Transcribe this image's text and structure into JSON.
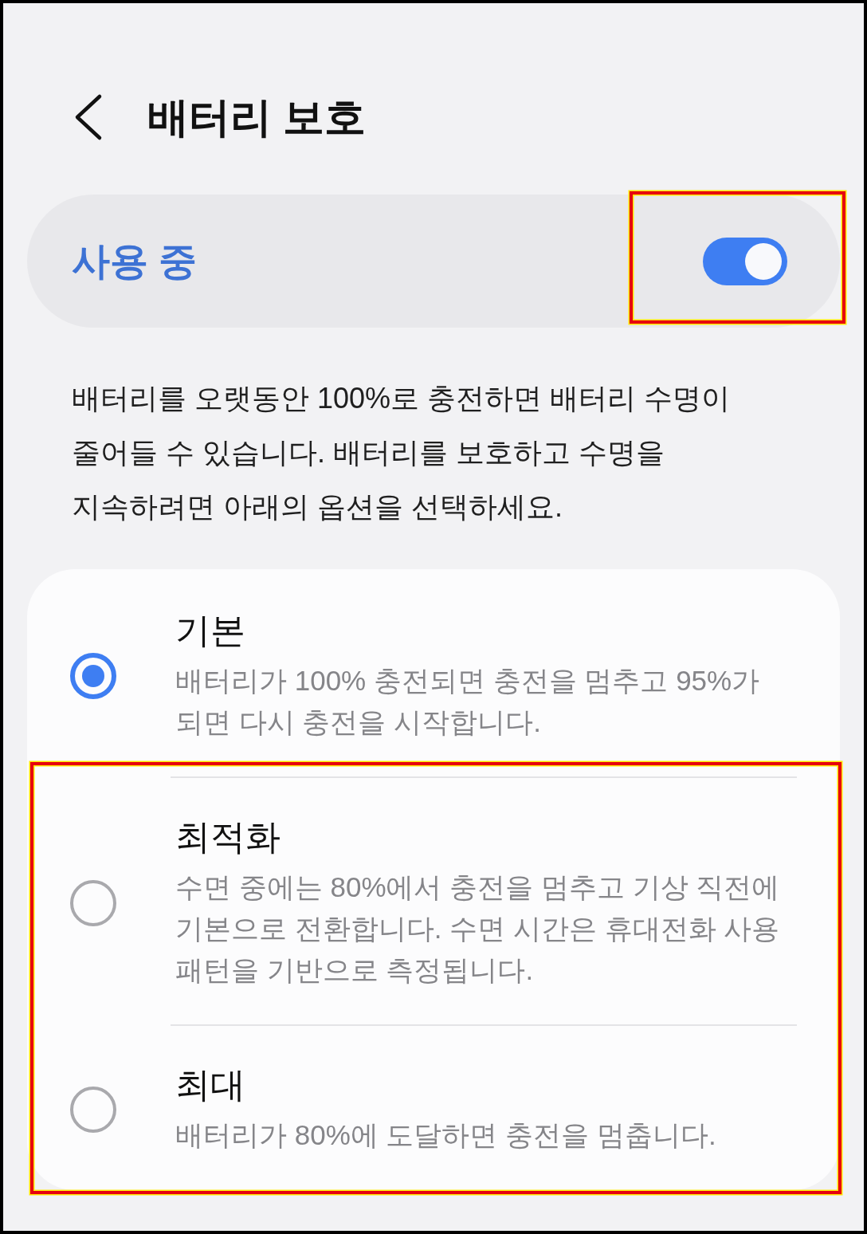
{
  "header": {
    "title": "배터리 보호"
  },
  "master_switch": {
    "label": "사용 중",
    "on": true,
    "highlighted": true
  },
  "description": "배터리를 오랫동안 100%로 충전하면 배터리 수명이 줄어들 수 있습니다. 배터리를 보호하고 수명을 지속하려면 아래의 옵션을 선택하세요.",
  "options": [
    {
      "title": "기본",
      "description": "배터리가 100% 충전되면 충전을 멈추고 95%가 되면 다시 충전을 시작합니다.",
      "selected": true,
      "highlighted": false
    },
    {
      "title": "최적화",
      "description": "수면 중에는 80%에서 충전을 멈추고 기상 직전에 기본으로 전환합니다. 수면 시간은 휴대전화 사용 패턴을 기반으로 측정됩니다.",
      "selected": false,
      "highlighted": true
    },
    {
      "title": "최대",
      "description": "배터리가 80%에 도달하면 충전을 멈춥니다.",
      "selected": false,
      "highlighted": true
    }
  ]
}
